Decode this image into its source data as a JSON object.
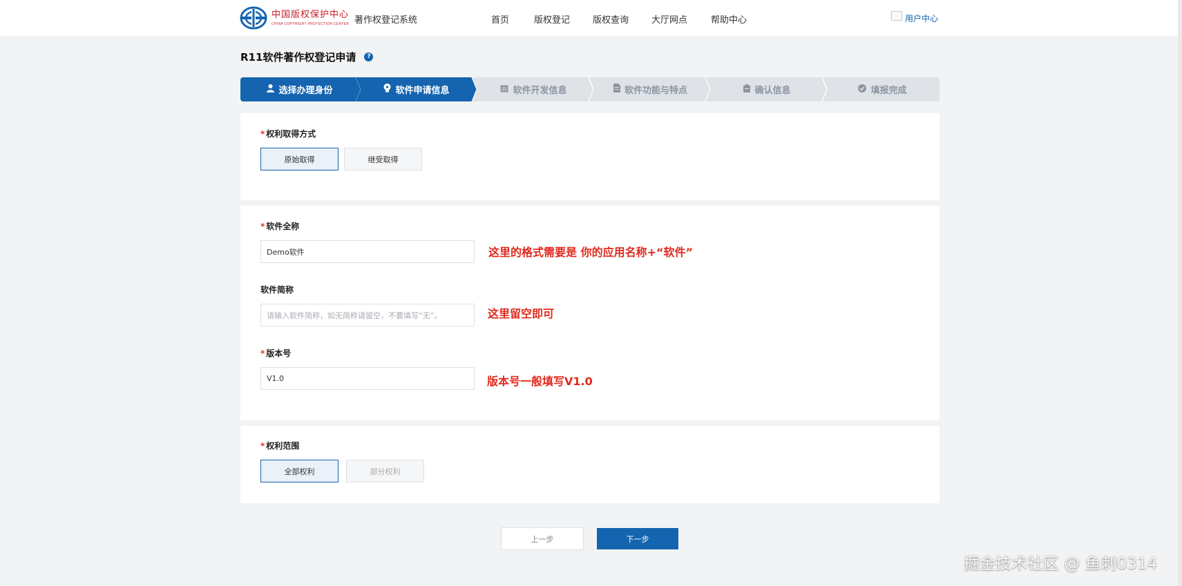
{
  "header": {
    "logo_cn": "中国版权保护中心",
    "logo_en": "CHINA COPYRIGHT PROTECTION CENTER",
    "system_name": "著作权登记系统",
    "nav": [
      "首页",
      "版权登记",
      "版权查询",
      "大厅网点",
      "帮助中心"
    ],
    "user_center": "用户中心"
  },
  "page": {
    "title": "R11软件著作权登记申请",
    "help_icon_text": "?"
  },
  "steps": [
    {
      "label": "选择办理身份",
      "icon": "user-icon",
      "state": "done"
    },
    {
      "label": "软件申请信息",
      "icon": "bulb-icon",
      "state": "current"
    },
    {
      "label": "软件开发信息",
      "icon": "calendar-icon",
      "state": "todo"
    },
    {
      "label": "软件功能与特点",
      "icon": "document-icon",
      "state": "todo"
    },
    {
      "label": "确认信息",
      "icon": "clipboard-icon",
      "state": "todo"
    },
    {
      "label": "填报完成",
      "icon": "check-circle-icon",
      "state": "todo"
    }
  ],
  "rights_acquisition": {
    "label": "权利取得方式",
    "required": "*",
    "options": [
      "原始取得",
      "继受取得"
    ],
    "selected": "原始取得"
  },
  "software_info": {
    "full_name": {
      "label": "软件全称",
      "required": "*",
      "value": "Demo软件",
      "note": "这里的格式需要是 你的应用名称+“软件”"
    },
    "short_name": {
      "label": "软件简称",
      "placeholder": "请输入软件简称，如无简称请留空，不要填写“无”。",
      "note": "这里留空即可"
    },
    "version": {
      "label": "版本号",
      "required": "*",
      "value": "V1.0",
      "note": "版本号一般填写V1.0"
    }
  },
  "rights_scope": {
    "label": "权利范围",
    "required": "*",
    "options": [
      "全部权利",
      "部分权利"
    ],
    "selected": "全部权利"
  },
  "footer": {
    "prev_label": "上一步",
    "next_label": "下一步"
  },
  "watermark": "掘金技术社区 @ 鱼刺0314",
  "colors": {
    "primary": "#1464b0",
    "annotation": "#e02a1e",
    "required": "#e0332b",
    "background": "#f2f3f5"
  }
}
